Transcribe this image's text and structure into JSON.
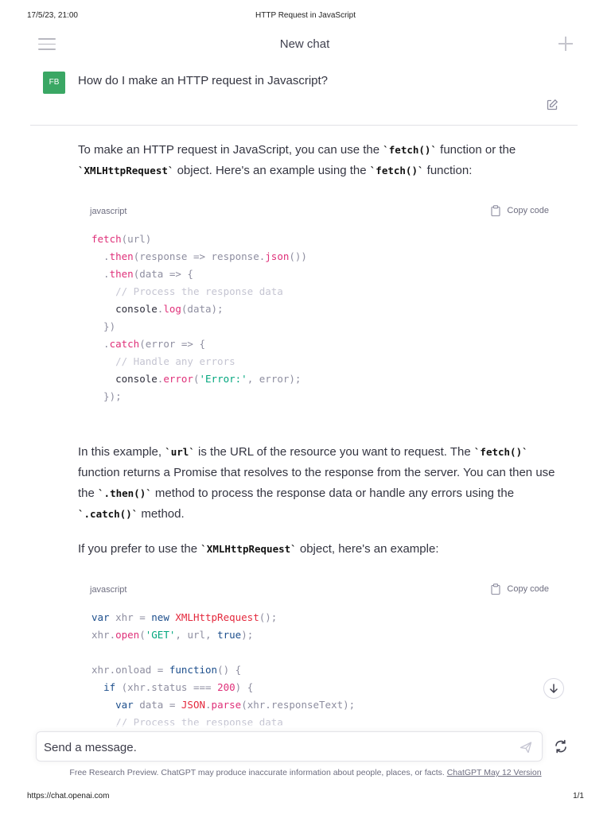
{
  "print": {
    "date": "17/5/23, 21:00",
    "title": "HTTP Request in JavaScript",
    "url": "https://chat.openai.com",
    "page": "1/1"
  },
  "header": {
    "title": "New chat"
  },
  "user": {
    "initials": "FB",
    "message": "How do I make an HTTP request in Javascript?",
    "avatar_color": "#3aa764"
  },
  "assistant": {
    "intro": [
      "To make an HTTP request in JavaScript, you can use the ",
      "`fetch()`",
      " function or the ",
      "`XMLHttpRequest`",
      " object. Here's an example using the ",
      "`fetch()`",
      " function:"
    ],
    "explanation": [
      "In this example, ",
      "`url`",
      " is the URL of the resource you want to request. The ",
      "`fetch()`",
      " function returns a Promise that resolves to the response from the server. You can then use the ",
      "`.then()`",
      " method to process the response data or handle any errors using the ",
      "`.catch()`",
      " method."
    ],
    "xhr_intro": [
      "If you prefer to use the ",
      "`XMLHttpRequest`",
      " object, here's an example:"
    ]
  },
  "code_blocks": [
    {
      "language": "javascript",
      "copy_label": "Copy code",
      "lines": [
        "fetch(url)",
        "  .then(response => response.json())",
        "  .then(data => {",
        "    // Process the response data",
        "    console.log(data);",
        "  })",
        "  .catch(error => {",
        "    // Handle any errors",
        "    console.error('Error:', error);",
        "  });"
      ]
    },
    {
      "language": "javascript",
      "copy_label": "Copy code",
      "lines": [
        "var xhr = new XMLHttpRequest();",
        "xhr.open('GET', url, true);",
        "",
        "xhr.onload = function() {",
        "  if (xhr.status === 200) {",
        "    var data = JSON.parse(xhr.responseText);",
        "    // Process the response data"
      ]
    }
  ],
  "composer": {
    "placeholder": "Send a message."
  },
  "footer": {
    "disclaimer": "Free Research Preview. ChatGPT may produce inaccurate information about people, places, or facts. ",
    "version_link": "ChatGPT May 12 Version"
  },
  "icons": {
    "menu": "hamburger-menu-icon",
    "new_chat": "plus-icon",
    "edit": "edit-icon",
    "copy": "clipboard-icon",
    "scroll_down": "arrow-down-icon",
    "send": "paper-plane-icon",
    "regenerate": "refresh-icon"
  }
}
